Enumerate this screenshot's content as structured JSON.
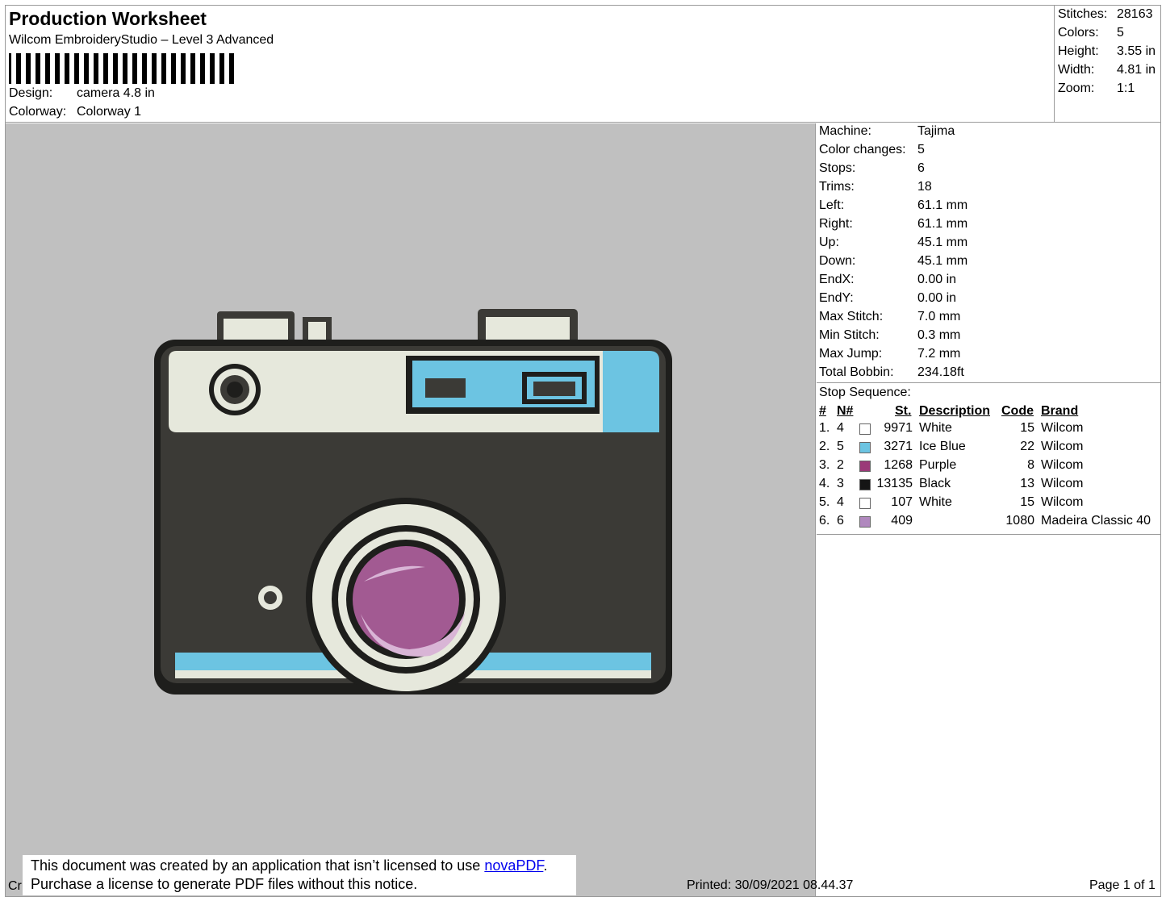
{
  "header": {
    "title": "Production Worksheet",
    "subtitle": "Wilcom EmbroideryStudio – Level 3 Advanced",
    "design_label": "Design:",
    "design_value": "camera 4.8 in",
    "colorway_label": "Colorway:",
    "colorway_value": "Colorway 1"
  },
  "stats": [
    {
      "label": "Stitches:",
      "value": "28163"
    },
    {
      "label": "Colors:",
      "value": "5"
    },
    {
      "label": "Height:",
      "value": "3.55 in"
    },
    {
      "label": "Width:",
      "value": "4.81 in"
    },
    {
      "label": "Zoom:",
      "value": "1:1"
    }
  ],
  "machine_info": [
    {
      "label": "Machine:",
      "value": "Tajima"
    },
    {
      "label": "Color changes:",
      "value": "5"
    },
    {
      "label": "Stops:",
      "value": "6"
    },
    {
      "label": "Trims:",
      "value": "18"
    },
    {
      "label": "Left:",
      "value": "61.1 mm"
    },
    {
      "label": "Right:",
      "value": "61.1 mm"
    },
    {
      "label": "Up:",
      "value": "45.1 mm"
    },
    {
      "label": "Down:",
      "value": "45.1 mm"
    },
    {
      "label": "EndX:",
      "value": "0.00 in"
    },
    {
      "label": "EndY:",
      "value": "0.00 in"
    },
    {
      "label": "Max Stitch:",
      "value": "7.0 mm"
    },
    {
      "label": "Min Stitch:",
      "value": "0.3 mm"
    },
    {
      "label": "Max Jump:",
      "value": "7.2 mm"
    },
    {
      "label": "Total Bobbin:",
      "value": "234.18ft"
    }
  ],
  "stop_sequence": {
    "title": "Stop Sequence:",
    "headers": {
      "num": "#",
      "n": "N#",
      "st": "St.",
      "description": "Description",
      "code": "Code",
      "brand": "Brand"
    },
    "rows": [
      {
        "num": "1.",
        "n": "4",
        "color": "#ffffff",
        "st": "9971",
        "description": "White",
        "code": "15",
        "brand": "Wilcom"
      },
      {
        "num": "2.",
        "n": "5",
        "color": "#6cc4e2",
        "st": "3271",
        "description": "Ice Blue",
        "code": "22",
        "brand": "Wilcom"
      },
      {
        "num": "3.",
        "n": "2",
        "color": "#9b3a78",
        "st": "1268",
        "description": "Purple",
        "code": "8",
        "brand": "Wilcom"
      },
      {
        "num": "4.",
        "n": "3",
        "color": "#151515",
        "st": "13135",
        "description": "Black",
        "code": "13",
        "brand": "Wilcom"
      },
      {
        "num": "5.",
        "n": "4",
        "color": "#ffffff",
        "st": "107",
        "description": "White",
        "code": "15",
        "brand": "Wilcom"
      },
      {
        "num": "6.",
        "n": "6",
        "color": "#b088be",
        "st": "409",
        "description": "",
        "code": "1080",
        "brand": "Madeira Classic 40"
      }
    ]
  },
  "footer": {
    "notice_line1": "This document was created by an application that isn’t licensed to use ",
    "notice_link": "novaPDF",
    "notice_period": ".",
    "notice_line2": "Purchase a license to generate PDF files without this notice.",
    "cr": "Cr",
    "printed": "Printed: 30/09/2021 08.44.37",
    "page": "Page 1 of 1"
  },
  "colors": {
    "canvas_bg": "#c0c0c0",
    "body_dark": "#3b3a36",
    "outline": "#1e1e1c",
    "cream": "#e6e8dc",
    "ice_blue": "#6cc4e2",
    "lens_purple": "#a25a92",
    "lens_highlight": "#d9b5d6"
  }
}
